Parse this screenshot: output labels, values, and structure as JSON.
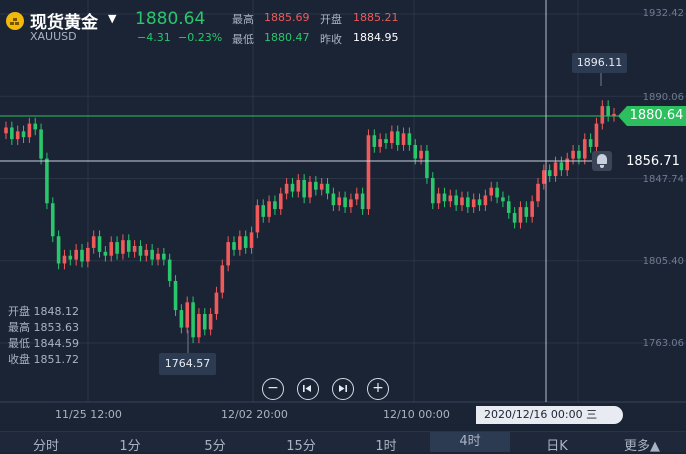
{
  "header": {
    "symbol_name": "现货黄金",
    "symbol_code": "XAUUSD",
    "price": "1880.64",
    "change": "−4.31",
    "change_pct": "−0.23%",
    "stats": {
      "high_label": "最高",
      "high_value": "1885.69",
      "open_label": "开盘",
      "open_value": "1885.21",
      "low_label": "最低",
      "low_value": "1880.47",
      "prev_label": "昨收",
      "prev_value": "1884.95"
    }
  },
  "colors": {
    "up": "#f05a5a",
    "down": "#29c66b",
    "background": "#1b2435",
    "accent_green": "#2cbf5e"
  },
  "chart_data": {
    "type": "candlestick",
    "y_ticks": [
      "1932.42",
      "1890.06",
      "1847.74",
      "1805.40",
      "1763.06"
    ],
    "x_ticks": [
      "11/25 12:00",
      "12/02 20:00",
      "12/10 00:00"
    ],
    "ylim": [
      1740,
      1935
    ],
    "current_price": "1880.64",
    "alert_price": "1856.71",
    "max_label": "1896.11",
    "min_label": "1764.57",
    "crosshair_date": "2020/12/16 00:00 三",
    "candles": [
      {
        "o": 1871,
        "c": 1874
      },
      {
        "o": 1874,
        "c": 1868
      },
      {
        "o": 1868,
        "c": 1872
      },
      {
        "o": 1872,
        "c": 1869
      },
      {
        "o": 1869,
        "c": 1876
      },
      {
        "o": 1876,
        "c": 1873
      },
      {
        "o": 1873,
        "c": 1858
      },
      {
        "o": 1858,
        "c": 1835
      },
      {
        "o": 1835,
        "c": 1818
      },
      {
        "o": 1818,
        "c": 1804
      },
      {
        "o": 1804,
        "c": 1808
      },
      {
        "o": 1808,
        "c": 1806
      },
      {
        "o": 1806,
        "c": 1811
      },
      {
        "o": 1811,
        "c": 1805
      },
      {
        "o": 1805,
        "c": 1812
      },
      {
        "o": 1812,
        "c": 1818
      },
      {
        "o": 1818,
        "c": 1810
      },
      {
        "o": 1810,
        "c": 1808
      },
      {
        "o": 1808,
        "c": 1815
      },
      {
        "o": 1815,
        "c": 1809
      },
      {
        "o": 1809,
        "c": 1816
      },
      {
        "o": 1816,
        "c": 1810
      },
      {
        "o": 1810,
        "c": 1813
      },
      {
        "o": 1813,
        "c": 1808
      },
      {
        "o": 1808,
        "c": 1811
      },
      {
        "o": 1811,
        "c": 1806
      },
      {
        "o": 1806,
        "c": 1809
      },
      {
        "o": 1809,
        "c": 1806
      },
      {
        "o": 1806,
        "c": 1795
      },
      {
        "o": 1795,
        "c": 1780
      },
      {
        "o": 1780,
        "c": 1771
      },
      {
        "o": 1771,
        "c": 1784
      },
      {
        "o": 1784,
        "c": 1766
      },
      {
        "o": 1766,
        "c": 1778
      },
      {
        "o": 1778,
        "c": 1770
      },
      {
        "o": 1770,
        "c": 1778
      },
      {
        "o": 1778,
        "c": 1789
      },
      {
        "o": 1789,
        "c": 1803
      },
      {
        "o": 1803,
        "c": 1815
      },
      {
        "o": 1815,
        "c": 1811
      },
      {
        "o": 1811,
        "c": 1818
      },
      {
        "o": 1818,
        "c": 1812
      },
      {
        "o": 1812,
        "c": 1820
      },
      {
        "o": 1820,
        "c": 1834
      },
      {
        "o": 1834,
        "c": 1828
      },
      {
        "o": 1828,
        "c": 1836
      },
      {
        "o": 1836,
        "c": 1832
      },
      {
        "o": 1832,
        "c": 1840
      },
      {
        "o": 1840,
        "c": 1845
      },
      {
        "o": 1845,
        "c": 1841
      },
      {
        "o": 1841,
        "c": 1847
      },
      {
        "o": 1847,
        "c": 1838
      },
      {
        "o": 1838,
        "c": 1846
      },
      {
        "o": 1846,
        "c": 1842
      },
      {
        "o": 1842,
        "c": 1845
      },
      {
        "o": 1845,
        "c": 1840
      },
      {
        "o": 1840,
        "c": 1834
      },
      {
        "o": 1834,
        "c": 1838
      },
      {
        "o": 1838,
        "c": 1833
      },
      {
        "o": 1833,
        "c": 1837
      },
      {
        "o": 1837,
        "c": 1840
      },
      {
        "o": 1840,
        "c": 1832
      },
      {
        "o": 1832,
        "c": 1870
      },
      {
        "o": 1870,
        "c": 1864
      },
      {
        "o": 1864,
        "c": 1868
      },
      {
        "o": 1868,
        "c": 1866
      },
      {
        "o": 1866,
        "c": 1872
      },
      {
        "o": 1872,
        "c": 1865
      },
      {
        "o": 1865,
        "c": 1871
      },
      {
        "o": 1871,
        "c": 1865
      },
      {
        "o": 1865,
        "c": 1858
      },
      {
        "o": 1858,
        "c": 1862
      },
      {
        "o": 1862,
        "c": 1848
      },
      {
        "o": 1848,
        "c": 1835
      },
      {
        "o": 1835,
        "c": 1840
      },
      {
        "o": 1840,
        "c": 1836
      },
      {
        "o": 1836,
        "c": 1839
      },
      {
        "o": 1839,
        "c": 1834
      },
      {
        "o": 1834,
        "c": 1838
      },
      {
        "o": 1838,
        "c": 1833
      },
      {
        "o": 1833,
        "c": 1837
      },
      {
        "o": 1837,
        "c": 1834
      },
      {
        "o": 1834,
        "c": 1839
      },
      {
        "o": 1839,
        "c": 1843
      },
      {
        "o": 1843,
        "c": 1838
      },
      {
        "o": 1838,
        "c": 1836
      },
      {
        "o": 1836,
        "c": 1830
      },
      {
        "o": 1830,
        "c": 1825
      },
      {
        "o": 1825,
        "c": 1833
      },
      {
        "o": 1833,
        "c": 1828
      },
      {
        "o": 1828,
        "c": 1836
      },
      {
        "o": 1836,
        "c": 1845
      },
      {
        "o": 1845,
        "c": 1852
      },
      {
        "o": 1852,
        "c": 1849
      },
      {
        "o": 1849,
        "c": 1856
      },
      {
        "o": 1856,
        "c": 1852
      },
      {
        "o": 1852,
        "c": 1858
      },
      {
        "o": 1858,
        "c": 1862
      },
      {
        "o": 1862,
        "c": 1858
      },
      {
        "o": 1858,
        "c": 1868
      },
      {
        "o": 1868,
        "c": 1864
      },
      {
        "o": 1864,
        "c": 1876
      },
      {
        "o": 1876,
        "c": 1885
      },
      {
        "o": 1885,
        "c": 1880
      },
      {
        "o": 1880,
        "c": 1881
      }
    ]
  },
  "ohlc_info": {
    "open_label": "开盘",
    "open_value": "1848.12",
    "high_label": "最高",
    "high_value": "1853.63",
    "low_label": "最低",
    "low_value": "1844.59",
    "close_label": "收盘",
    "close_value": "1851.72"
  },
  "controls": {
    "zoom_out": "−",
    "zoom_in": "+"
  },
  "tabs": [
    "分时",
    "1分",
    "5分",
    "15分",
    "1时",
    "4时",
    "日K",
    "更多▲"
  ],
  "active_tab": "4时"
}
